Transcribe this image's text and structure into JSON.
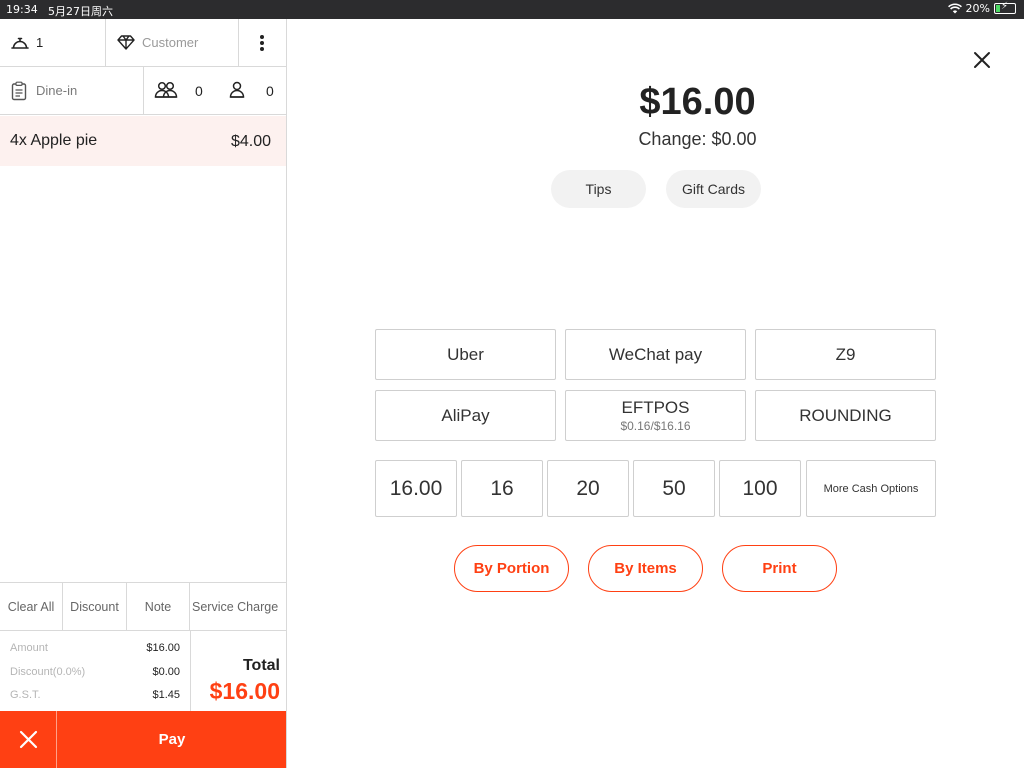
{
  "status_bar": {
    "time": "19:34",
    "date": "5月27日周六",
    "battery": "20%",
    "battery_level": 0.2
  },
  "order_panel": {
    "seat_count": "1",
    "customer_placeholder": "Customer",
    "order_type": "Dine-in",
    "guests_count": "0",
    "staff_count": "0",
    "items": [
      {
        "name": "4x Apple pie",
        "price": "$4.00"
      }
    ],
    "actions": [
      "Clear All",
      "Discount",
      "Note",
      "Service Charge"
    ],
    "summary": {
      "amount_label": "Amount",
      "amount_value": "$16.00",
      "discount_label": "Discount(0.0%)",
      "discount_value": "$0.00",
      "gst_label": "G.S.T.",
      "gst_value": "$1.45",
      "total_label": "Total",
      "total_value": "$16.00"
    },
    "pay_label": "Pay"
  },
  "payment": {
    "amount_due": "$16.00",
    "change": "Change: $0.00",
    "pills": [
      "Tips",
      "Gift Cards"
    ],
    "methods": [
      {
        "label": "Uber",
        "sub": ""
      },
      {
        "label": "WeChat pay",
        "sub": ""
      },
      {
        "label": "Z9",
        "sub": ""
      },
      {
        "label": "AliPay",
        "sub": ""
      },
      {
        "label": "EFTPOS",
        "sub": "$0.16/$16.16"
      },
      {
        "label": "ROUNDING",
        "sub": ""
      }
    ],
    "cash_options": [
      "16.00",
      "16",
      "20",
      "50",
      "100"
    ],
    "more_cash_label": "More Cash Options",
    "split_buttons": [
      "By Portion",
      "By Items",
      "Print"
    ]
  },
  "colors": {
    "accent": "#ff4013",
    "highlight_row": "#fdf1ef",
    "status_bar": "#2c2c2e",
    "battery_charge": "#4cd964"
  }
}
